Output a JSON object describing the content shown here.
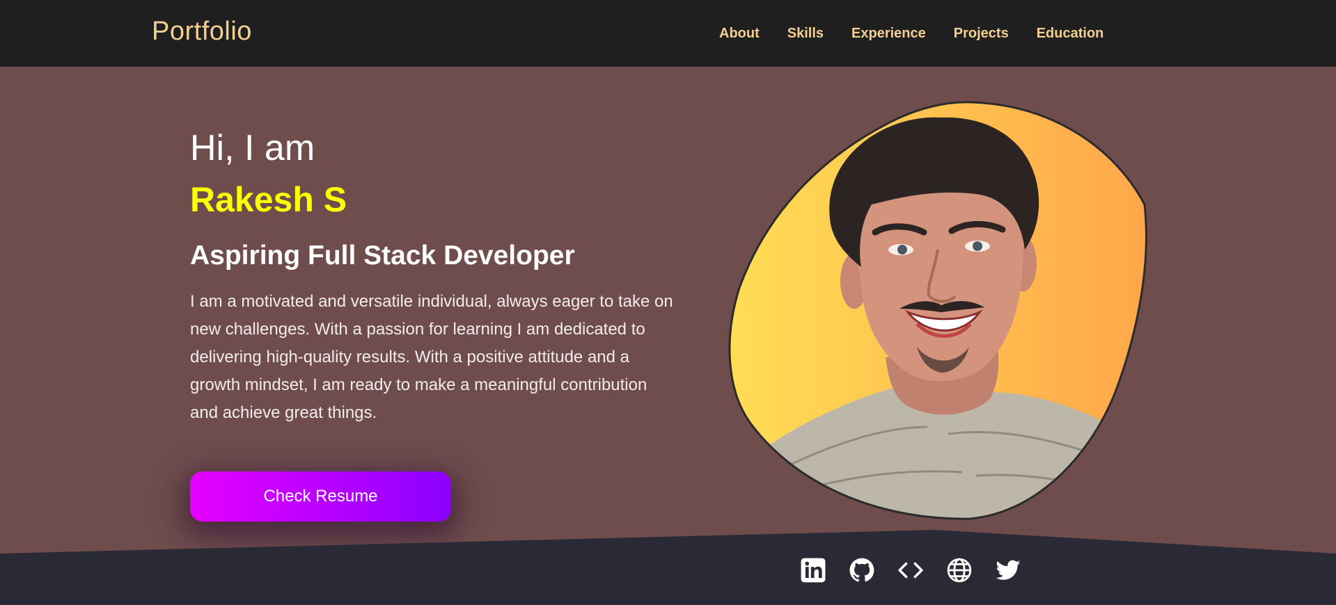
{
  "navbar": {
    "brand": "Portfolio",
    "links": [
      {
        "label": "About"
      },
      {
        "label": "Skills"
      },
      {
        "label": "Experience"
      },
      {
        "label": "Projects"
      },
      {
        "label": "Education"
      }
    ]
  },
  "hero": {
    "greeting": "Hi, I am",
    "name": "Rakesh S",
    "role": "Aspiring Full Stack Developer",
    "bio": "I am a motivated and versatile individual, always eager to take on new challenges. With a passion for learning I am dedicated to delivering high-quality results. With a positive attitude and a growth mindset, I am ready to make a meaningful contribution and achieve great things.",
    "cta_label": "Check Resume"
  },
  "socials": [
    {
      "icon": "linkedin-icon"
    },
    {
      "icon": "github-icon"
    },
    {
      "icon": "code-icon"
    },
    {
      "icon": "globe-icon"
    },
    {
      "icon": "twitter-icon"
    }
  ],
  "colors": {
    "navbar_bg": "#1f1f1f",
    "nav_text": "#f3cf93",
    "hero_bg": "#6f4d4d",
    "name_color": "#ffff00",
    "button_gradient_start": "#e600ff",
    "button_gradient_end": "#8b00ff",
    "footer_bg": "#2a2a36"
  }
}
